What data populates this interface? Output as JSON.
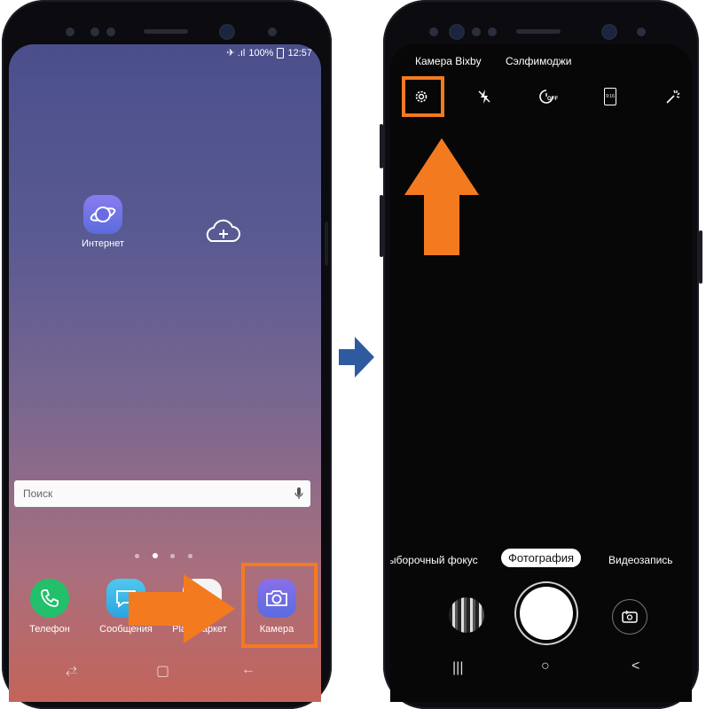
{
  "left_phone": {
    "status": {
      "icons": "✈ .ıl",
      "battery": "100%",
      "time": "12:57"
    },
    "apps": {
      "internet_label": "Интернет",
      "phone_label": "Телефон",
      "messages_label": "Сообщения",
      "playmarket_label": "Play Маркет",
      "camera_label": "Камера"
    },
    "search": {
      "placeholder": "Поиск"
    },
    "nav": {
      "recent": "⥄",
      "home": "▢",
      "back": "←"
    }
  },
  "right_phone": {
    "top_modes": [
      "Камера Bixby",
      "Сэлфимоджи"
    ],
    "bottom_modes": [
      "ыборочный фокус",
      "Фотография",
      "Видеозапись"
    ],
    "timer_label": "OFF",
    "ratio_label": "9:16",
    "nav": {
      "recent": "|||",
      "home": "○",
      "back": "<"
    }
  },
  "colors": {
    "highlight": "#f47a20",
    "transition_arrow": "#2f5aa0",
    "home_gradient_top": "#4a4f8c",
    "home_gradient_bottom": "#c4645a"
  },
  "icons": [
    "settings-gear-icon",
    "flash-off-icon",
    "timer-off-icon",
    "aspect-ratio-icon",
    "effects-icon",
    "mic-icon",
    "cloud-add-icon",
    "internet-planet-icon",
    "phone-icon",
    "messages-icon",
    "camera-icon",
    "flip-camera-icon"
  ]
}
